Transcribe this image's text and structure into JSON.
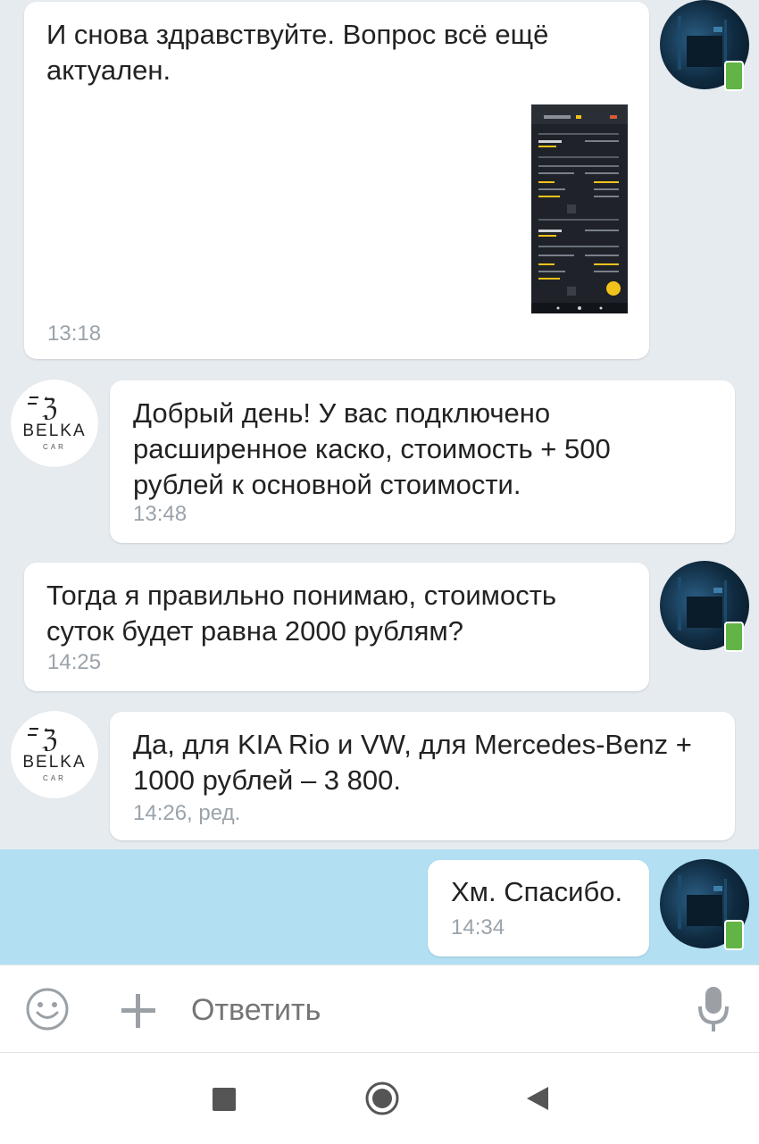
{
  "messages": [
    {
      "text": "И снова здравствуйте. Вопрос всё ещё актуален.",
      "time": "13:18"
    },
    {
      "sender": "BELKA",
      "sender_sub": "CAR",
      "text": "Добрый день! У вас подключено расширенное каско, стоимость + 500 рублей к основной стоимости.",
      "time": "13:48"
    },
    {
      "text": "Тогда я правильно понимаю, стоимость суток будет равна 2000 рублям?",
      "time": "14:25"
    },
    {
      "sender": "BELKA",
      "sender_sub": "CAR",
      "text": "Да, для KIA Rio и VW, для Mercedes-Benz + 1000 рублей – 3 800.",
      "time": "14:26, ред."
    },
    {
      "text": "Хм. Спасибо.",
      "time": "14:34"
    }
  ],
  "composer": {
    "placeholder": "Ответить"
  },
  "icons": {
    "emoji": "emoji-icon",
    "attach": "plus-icon",
    "mic": "microphone-icon",
    "nav_recent": "square-icon",
    "nav_home": "circle-icon",
    "nav_back": "triangle-back-icon"
  },
  "colors": {
    "highlight": "#b2e0f2",
    "online_badge": "#62b446"
  }
}
